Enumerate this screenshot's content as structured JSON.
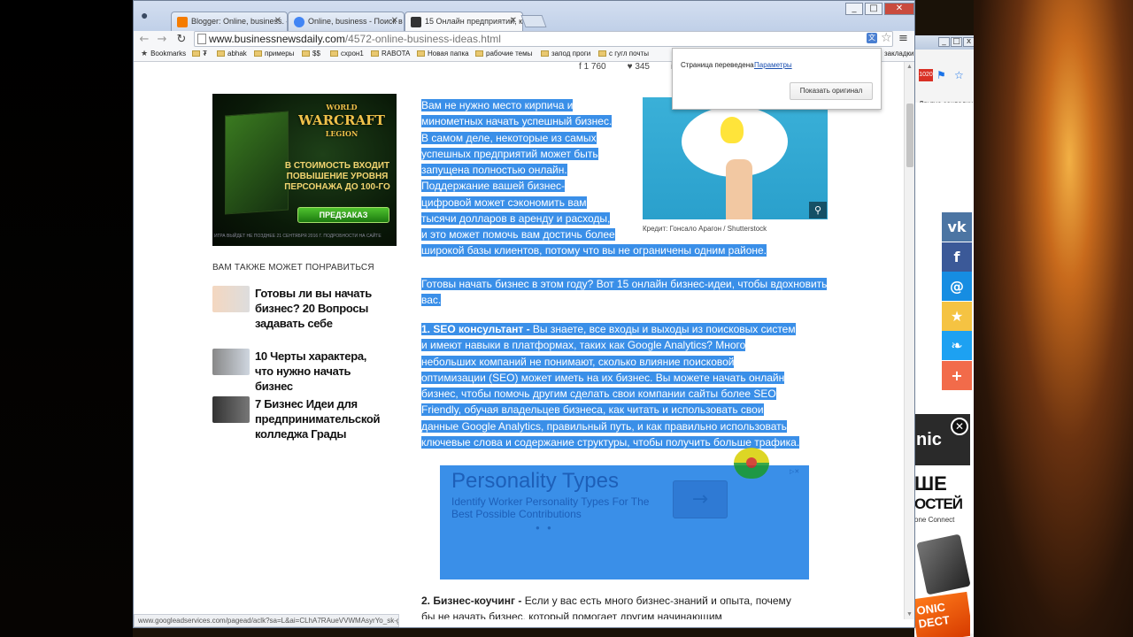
{
  "browser": {
    "tabs": [
      {
        "title": "Blogger: Online, business. –",
        "favicon_color": "#f57c00"
      },
      {
        "title": "Online, business - Поиск в G",
        "favicon_color": "#4285f4"
      },
      {
        "title": "15 Онлайн предприятий, ко",
        "favicon_color": "#333333"
      }
    ],
    "url_host": "www.businessnewsdaily.com",
    "url_path": "/4572-online-business-ideas.html",
    "bookmarks": [
      "Bookmarks",
      "₮",
      "abhak",
      "примеры",
      "$$",
      "схрон1",
      "RABOTA",
      "Новая папка",
      "рабочие темы",
      "запод проги",
      "с гугл почты",
      "закладки"
    ],
    "other_bookmarks": "Другие закладки",
    "status_url": "www.googleadservices.com/pagead/aclk?sa=L&ai=CLhA7RAueVVWMAsyrYo_sk-gN..."
  },
  "translate_popup": {
    "message": "Страница переведена",
    "params_link": "Параметры",
    "show_original": "Показать оригинал"
  },
  "share_counts": {
    "first": "1 760",
    "second": "345"
  },
  "sidebar": {
    "wow_ad": {
      "logo_top": "WORLD",
      "logo_main": "WARCRAFT",
      "logo_sub": "LEGION",
      "text": "В СТОИМОСТЬ ВХОДИТ ПОВЫШЕНИЕ УРОВНЯ ПЕРСОНАЖА ДО 100-ГО",
      "button": "ПРЕДЗАКАЗ",
      "fine_print": "ИГРА ВЫЙДЕТ НЕ ПОЗДНЕЕ 21 СЕНТЯБРЯ 2016 Г. ПОДРОБНОСТИ НА САЙТЕ"
    },
    "also_like": "ВАМ ТАКЖЕ МОЖЕТ ПОНРАВИТЬСЯ",
    "related": [
      {
        "title": "Готовы ли вы начать бизнес? 20 Вопросы задавать себе"
      },
      {
        "title": "10 Черты характера, что нужно начать бизнес"
      },
      {
        "title": "7 Бизнес Идеи для предпринимательской колледжа Грады"
      }
    ]
  },
  "article": {
    "p1_lines": [
      "Вам не нужно место кирпича и",
      "минометных начать успешный бизнес.",
      "В самом деле, некоторые из самых",
      "успешных предприятий может быть",
      "запущена полностью онлайн.",
      "Поддержание вашей бизнес-",
      "цифровой может сэкономить вам",
      "тысячи долларов в аренду и расходы,",
      "и это может помочь вам достичь более"
    ],
    "p1_last": "широкой базы клиентов, потому что вы не ограничены одним районе.",
    "p2": "Готовы начать бизнес в этом году? Вот 15 онлайн бизнес-идеи, чтобы вдохновить вас.",
    "p3_head": "1. SEO консультант -",
    "p3_lines": [
      " Вы знаете, все входы и выходы из поисковых систем",
      "и имеют навыки в платформах, таких как Google Analytics? Много",
      "небольших компаний не понимают, сколько влияние поисковой",
      "оптимизации (SEO) может иметь на их бизнес. Вы можете начать онлайн",
      "бизнес, чтобы помочь другим сделать свои компании сайты более SEO",
      "Friendly, обучая владельцев бизнеса, как читать и использовать свои",
      "данные Google Analytics, правильный путь, и как правильно использовать",
      "ключевые слова и содержание структуры, чтобы получить больше трафика."
    ],
    "p4_head": "2. Бизнес-коучинг -",
    "p4_lines": [
      " Если у вас есть много бизнес-знаний и опыта, почему",
      "бы не начать бизнес, который помогает другим начинающим"
    ],
    "image_credit": "Кредит: Гонсало Арагон / Shutterstock"
  },
  "personality_ad": {
    "title": "Personality Types",
    "subtitle": "Identify Worker Personality Types For The Best Possible Contributions",
    "arrow": "→"
  },
  "share_bar": [
    {
      "icon": "vk-icon",
      "glyph": "vk",
      "color": "#4c75a3"
    },
    {
      "icon": "facebook-icon",
      "glyph": "f",
      "color": "#3b5998"
    },
    {
      "icon": "mail-icon",
      "glyph": "@",
      "color": "#168de2"
    },
    {
      "icon": "bookmark-star-icon",
      "glyph": "★",
      "color": "#f5c342"
    },
    {
      "icon": "twitter-icon",
      "glyph": "❧",
      "color": "#1da1f2"
    },
    {
      "icon": "more-share-icon",
      "glyph": "+",
      "color": "#f26b4a"
    }
  ],
  "right_ad": {
    "brand": "nic",
    "line1": "ШЕ",
    "line2": "ОСТЕЙ",
    "line3": "one Connect",
    "promo": "ONIC DECT"
  }
}
